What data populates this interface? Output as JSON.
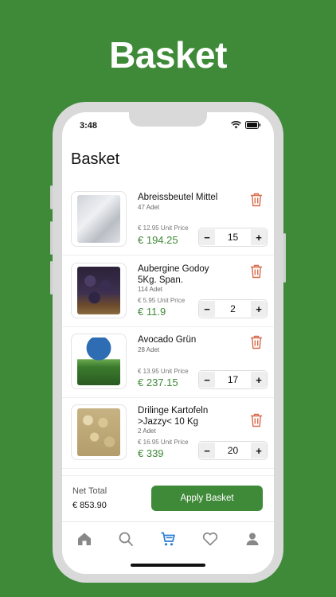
{
  "hero": {
    "title": "Basket"
  },
  "status_bar": {
    "time": "3:48"
  },
  "page": {
    "title": "Basket"
  },
  "items": [
    {
      "name": "Abreissbeutel Mittel",
      "qty": "47 Adet",
      "unit_price": "€ 12.95 Unit Price",
      "total": "€ 194.25",
      "stepper_value": "15"
    },
    {
      "name": "Aubergine Godoy 5Kg. Span.",
      "qty": "114 Adet",
      "unit_price": "€ 5.95 Unit Price",
      "total": "€ 11.9",
      "stepper_value": "2"
    },
    {
      "name": "Avocado Grün",
      "qty": "28 Adet",
      "unit_price": "€ 13.95 Unit Price",
      "total": "€ 237.15",
      "stepper_value": "17"
    },
    {
      "name": "Drilinge Kartofeln >Jazzy< 10 Kg",
      "qty": "2 Adet",
      "unit_price": "€ 16.95 Unit Price",
      "total": "€ 339",
      "stepper_value": "20"
    }
  ],
  "stepper": {
    "minus": "−",
    "plus": "+"
  },
  "footer": {
    "net_label": "Net Total",
    "net_value": "€ 853.90",
    "apply_label": "Apply Basket"
  },
  "tabbar": {
    "items": [
      "home-icon",
      "search-icon",
      "cart-icon",
      "heart-icon",
      "user-icon"
    ],
    "active": "cart-icon"
  },
  "colors": {
    "brand": "#3f8a38",
    "trash": "#d9694a",
    "active_tab": "#2a7fd4",
    "inactive_tab": "#888888"
  }
}
